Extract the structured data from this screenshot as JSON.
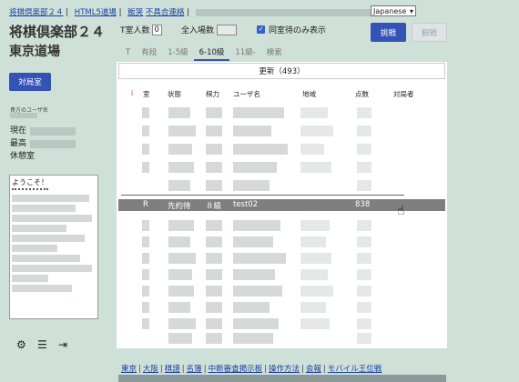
{
  "top_links": {
    "home": "将棋倶楽部２４",
    "html5": "HTML5道場",
    "help": "飯哭",
    "bug_report": "不具合連絡",
    "sep": "|"
  },
  "language": {
    "selected": "Japanese"
  },
  "header": {
    "club_title": "将棋倶楽部２４",
    "dojo_title": "東京道場"
  },
  "sidebar": {
    "room_button": "対局室",
    "user_label": "貴方のユーザ名",
    "current": "現在",
    "highest": "最高",
    "lounge": "休憩室",
    "chat_welcome": "ようこそ！"
  },
  "filters": {
    "t_rooms_label": "T室人数",
    "t_rooms_value": "0",
    "all_games_label": "全入場数",
    "wait_only_label": "同室待のみ表示",
    "wait_only_checked": true,
    "check_glyph": "✓"
  },
  "actions": {
    "challenge": "挑戦",
    "spectate": "観戦"
  },
  "tabs": [
    {
      "label": "T",
      "active": false
    },
    {
      "label": "有段",
      "active": false
    },
    {
      "label": "1-5級",
      "active": false
    },
    {
      "label": "6-10級",
      "active": true
    },
    {
      "label": "11級-",
      "active": false
    },
    {
      "label": "検索",
      "active": false
    }
  ],
  "refresh": {
    "label": "更新（493）"
  },
  "table": {
    "headers": {
      "info": "i",
      "room": "室",
      "state": "状態",
      "rank": "棋力",
      "user": "ユーザ名",
      "region": "地域",
      "score": "点数",
      "opponent": "対局者"
    },
    "selected_row": {
      "room": "R",
      "state": "先約待",
      "rank": "８級",
      "user": "test02",
      "score": "838"
    }
  },
  "footer": {
    "links": [
      "東京",
      "大阪",
      "棋譜",
      "名簿",
      "中断審査掲示板",
      "操作方法",
      "会報",
      "モバイル王位戦"
    ]
  },
  "icons": {
    "gear": "⚙",
    "list": "☰",
    "logout": "⇥",
    "dropdown": "▾",
    "cursor": "☝"
  },
  "colors": {
    "background": "#cfe0d8",
    "accent": "#3553b6",
    "selected_row": "#7f7f7f"
  }
}
